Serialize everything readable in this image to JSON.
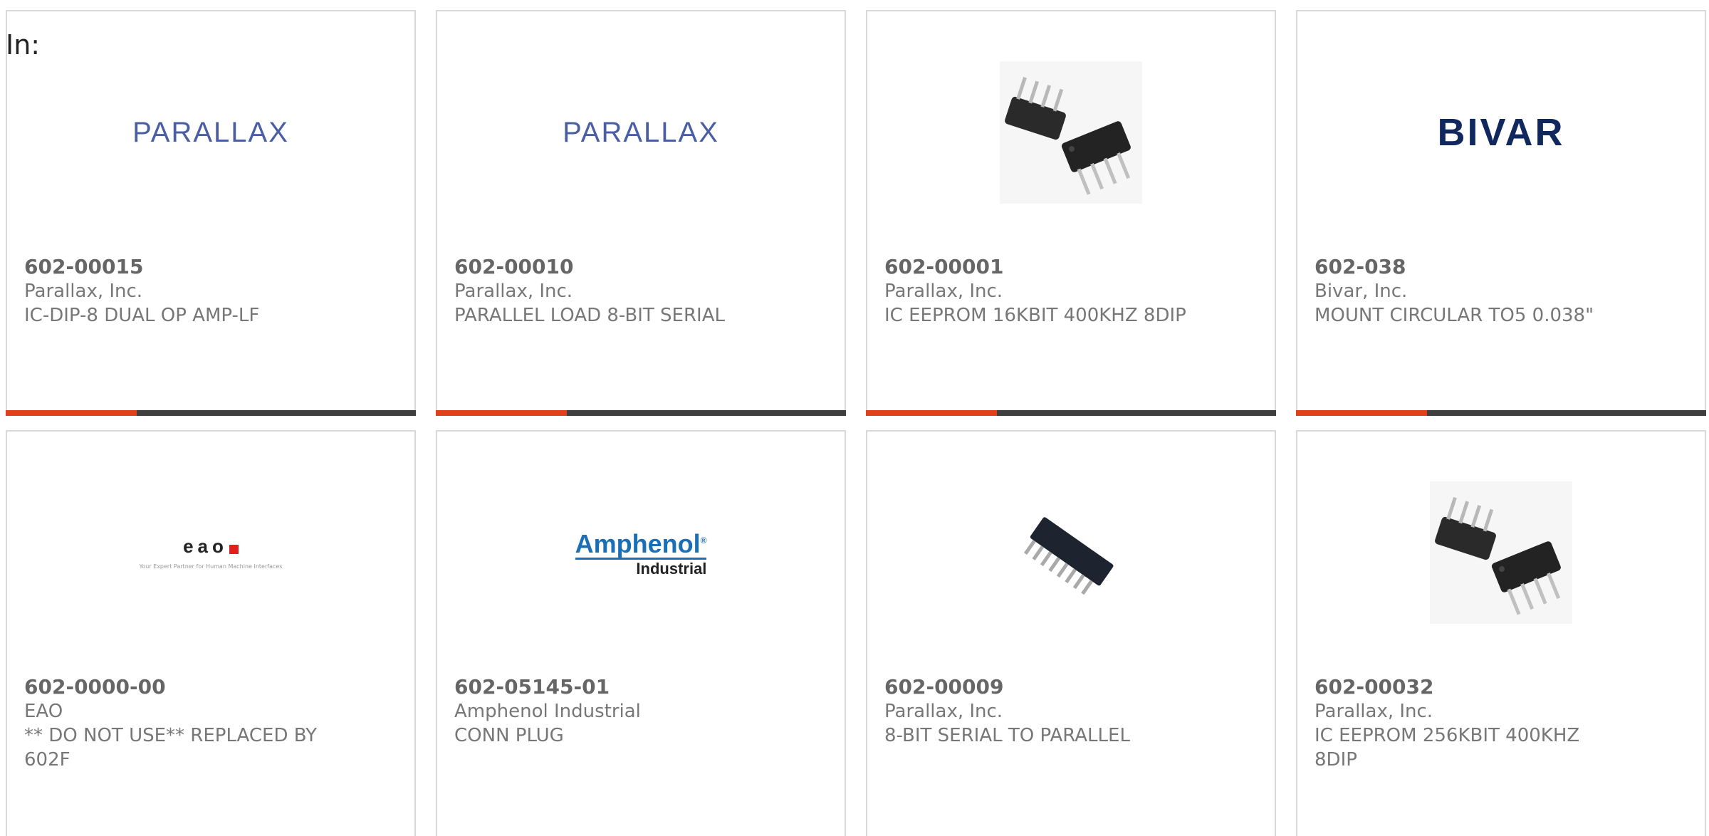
{
  "page": {
    "in_label": "In:"
  },
  "products": [
    {
      "part_number": "602-00015",
      "manufacturer": "Parallax, Inc.",
      "description": "IC-DIP-8 DUAL OP AMP-LF",
      "image": "parallax-logo",
      "logo_text": "PARALLAX"
    },
    {
      "part_number": "602-00010",
      "manufacturer": "Parallax, Inc.",
      "description": "PARALLEL LOAD 8-BIT SERIAL",
      "image": "parallax-logo",
      "logo_text": "PARALLAX"
    },
    {
      "part_number": "602-00001",
      "manufacturer": "Parallax, Inc.",
      "description": "IC EEPROM 16KBIT 400KHZ 8DIP",
      "image": "dip8-chips-photo"
    },
    {
      "part_number": "602-038",
      "manufacturer": "Bivar, Inc.",
      "description": "MOUNT CIRCULAR TO5 0.038\"",
      "image": "bivar-logo",
      "logo_text": "BIVAR"
    },
    {
      "part_number": "602-0000-00",
      "manufacturer": "EAO",
      "description": "** DO NOT USE** REPLACED BY 602F",
      "image": "eao-logo",
      "logo_text": "eao",
      "logo_tagline": "Your Expert Partner for Human Machine Interfaces"
    },
    {
      "part_number": "602-05145-01",
      "manufacturer": "Amphenol Industrial",
      "description": "CONN PLUG",
      "image": "amphenol-logo",
      "logo_text": "Amphenol",
      "logo_subtext": "Industrial"
    },
    {
      "part_number": "602-00009",
      "manufacturer": "Parallax, Inc.",
      "description": "8-BIT SERIAL TO PARALLEL",
      "image": "dip16-chip-photo"
    },
    {
      "part_number": "602-00032",
      "manufacturer": "Parallax, Inc.",
      "description": "IC EEPROM 256KBIT 400KHZ 8DIP",
      "image": "dip8-chips-photo"
    }
  ],
  "colors": {
    "accent": "#e0401a",
    "bar_track": "#3f3f3f",
    "card_border": "#d8d8d8",
    "text_gray": "#777777"
  },
  "progress": {
    "accent_fraction": 0.32
  }
}
